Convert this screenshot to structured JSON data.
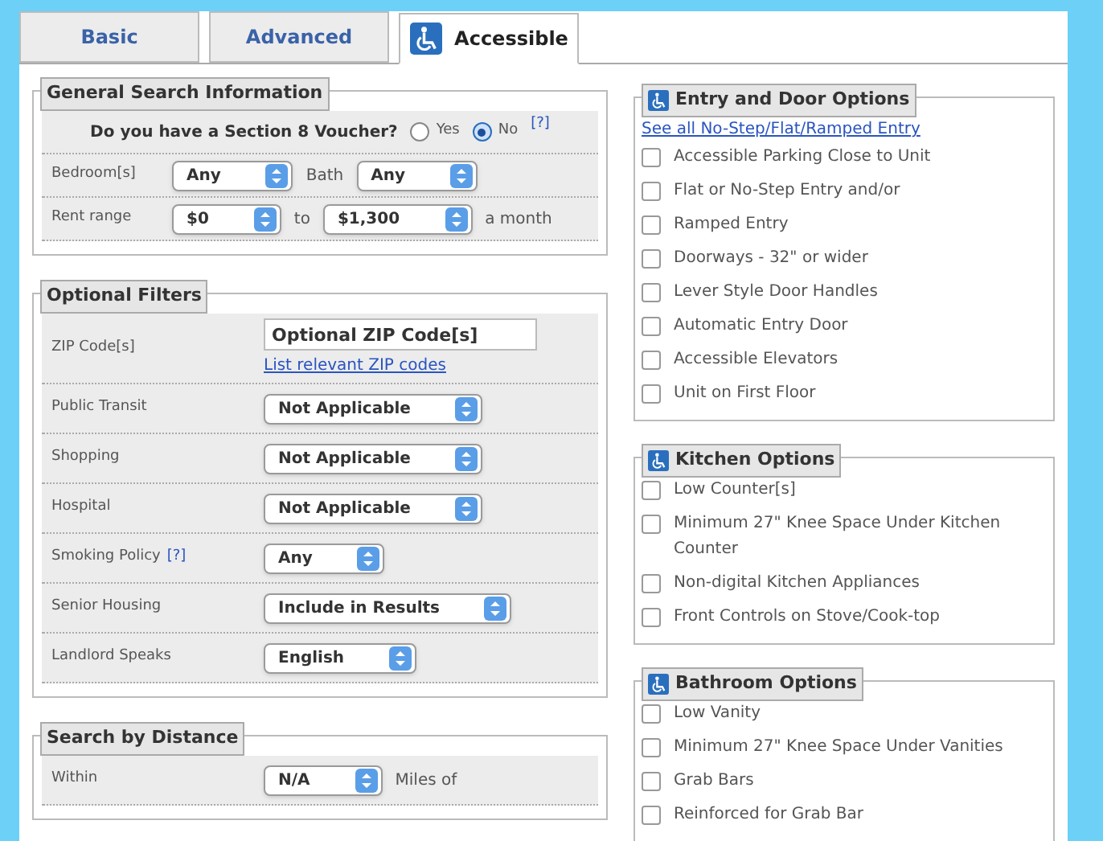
{
  "tabs": [
    {
      "label": "Basic",
      "selected": false,
      "icon": false
    },
    {
      "label": "Advanced",
      "selected": false,
      "icon": false
    },
    {
      "label": "Accessible",
      "selected": true,
      "icon": true
    }
  ],
  "general": {
    "title": "General Search Information",
    "voucher": {
      "question": "Do you have a Section 8 Voucher?",
      "options": [
        {
          "label": "Yes",
          "selected": false
        },
        {
          "label": "No",
          "selected": true
        }
      ],
      "help": "[?]"
    },
    "rows": [
      {
        "label": "Bedroom[s]",
        "controls": [
          {
            "kind": "select",
            "value": "Any"
          },
          {
            "kind": "text",
            "text": "Bath"
          },
          {
            "kind": "select",
            "value": "Any"
          }
        ]
      },
      {
        "label": "Rent range",
        "controls": [
          {
            "kind": "select",
            "value": "$0"
          },
          {
            "kind": "text",
            "text": "to"
          },
          {
            "kind": "select",
            "value": "$1,300"
          },
          {
            "kind": "text",
            "text": "a month"
          }
        ]
      }
    ]
  },
  "optional": {
    "title": "Optional Filters",
    "rows": [
      {
        "label": "ZIP Code[s]",
        "controls": [
          {
            "kind": "input",
            "placeholder": "Optional ZIP Code[s]"
          },
          {
            "kind": "link",
            "text": "List relevant ZIP codes"
          }
        ]
      },
      {
        "label": "Public Transit",
        "controls": [
          {
            "kind": "select",
            "value": "Not Applicable"
          }
        ]
      },
      {
        "label": "Shopping",
        "controls": [
          {
            "kind": "select",
            "value": "Not Applicable"
          }
        ]
      },
      {
        "label": "Hospital",
        "controls": [
          {
            "kind": "select",
            "value": "Not Applicable"
          }
        ]
      },
      {
        "label": "Smoking Policy",
        "help": "[?]",
        "controls": [
          {
            "kind": "select",
            "value": "Any"
          }
        ]
      },
      {
        "label": "Senior Housing",
        "controls": [
          {
            "kind": "select",
            "value": "Include in Results"
          }
        ]
      },
      {
        "label": "Landlord Speaks",
        "controls": [
          {
            "kind": "select",
            "value": "English"
          }
        ]
      }
    ]
  },
  "distance": {
    "title": "Search by Distance",
    "rows": [
      {
        "label": "Within",
        "controls": [
          {
            "kind": "select",
            "value": "N/A"
          },
          {
            "kind": "text",
            "text": "Miles of"
          }
        ]
      }
    ]
  },
  "option_groups": [
    {
      "title": "Entry and Door Options",
      "link": "See all No-Step/Flat/Ramped Entry",
      "options": [
        {
          "label": "Accessible Parking Close to Unit",
          "checked": false
        },
        {
          "label": "Flat or No-Step Entry and/or",
          "checked": false
        },
        {
          "label": "Ramped Entry",
          "checked": false
        },
        {
          "label": "Doorways - 32\" or wider",
          "checked": false
        },
        {
          "label": "Lever Style Door Handles",
          "checked": false
        },
        {
          "label": "Automatic Entry Door",
          "checked": false
        },
        {
          "label": "Accessible Elevators",
          "checked": false
        },
        {
          "label": "Unit on First Floor",
          "checked": false
        }
      ]
    },
    {
      "title": "Kitchen Options",
      "options": [
        {
          "label": "Low Counter[s]",
          "checked": false
        },
        {
          "label": "Minimum 27\" Knee Space Under Kitchen Counter",
          "checked": false
        },
        {
          "label": "Non-digital Kitchen Appliances",
          "checked": false
        },
        {
          "label": "Front Controls on Stove/Cook-top",
          "checked": false
        }
      ]
    },
    {
      "title": "Bathroom Options",
      "options": [
        {
          "label": "Low Vanity",
          "checked": false
        },
        {
          "label": "Minimum 27\" Knee Space Under Vanities",
          "checked": false
        },
        {
          "label": "Grab Bars",
          "checked": false
        },
        {
          "label": "Reinforced for Grab Bar",
          "checked": false
        }
      ]
    }
  ]
}
